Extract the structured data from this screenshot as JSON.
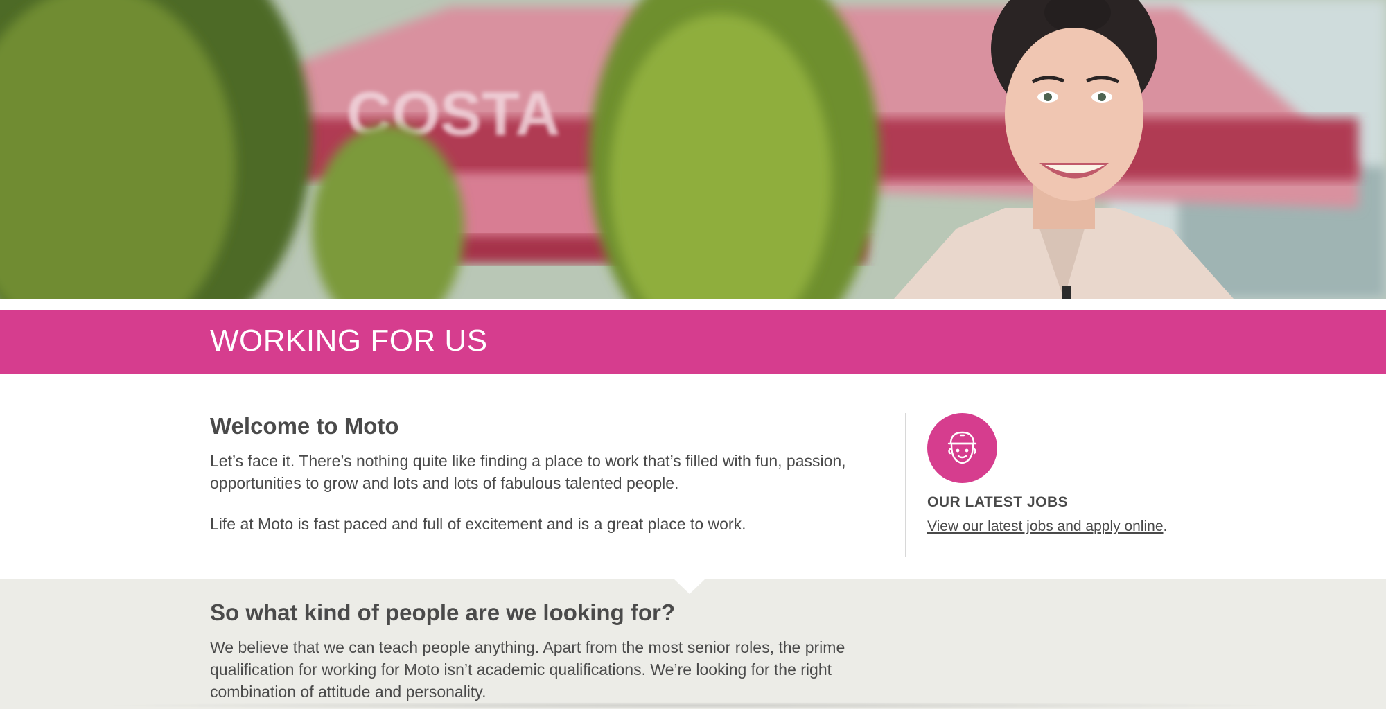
{
  "hero": {
    "image_alt": "Smiling Moto employee outside a cafe with pink parasols"
  },
  "banner": {
    "title": "WORKING FOR US"
  },
  "intro": {
    "heading": "Welcome to Moto",
    "paragraph1": "Let’s face it. There’s nothing quite like finding a place to work that’s filled with fun, passion, opportunities to grow and lots and lots of fabulous talented people.",
    "paragraph2": "Life at Moto is fast paced and full of excitement and is a great place to work."
  },
  "jobs": {
    "icon": "worker-cap-icon",
    "heading": "OUR LATEST JOBS",
    "link_text": "View our latest jobs and apply online",
    "after_link": "."
  },
  "people": {
    "heading": "So what kind of people are we looking for?",
    "paragraph": "We believe that we can teach people anything. Apart from the most senior roles, the prime qualification for working for Moto isn’t academic qualifications. We’re looking for the right combination of attitude and personality."
  },
  "colors": {
    "brand_pink": "#d63d8e",
    "text": "#4a4a4a",
    "grey_section": "#ecece7"
  }
}
